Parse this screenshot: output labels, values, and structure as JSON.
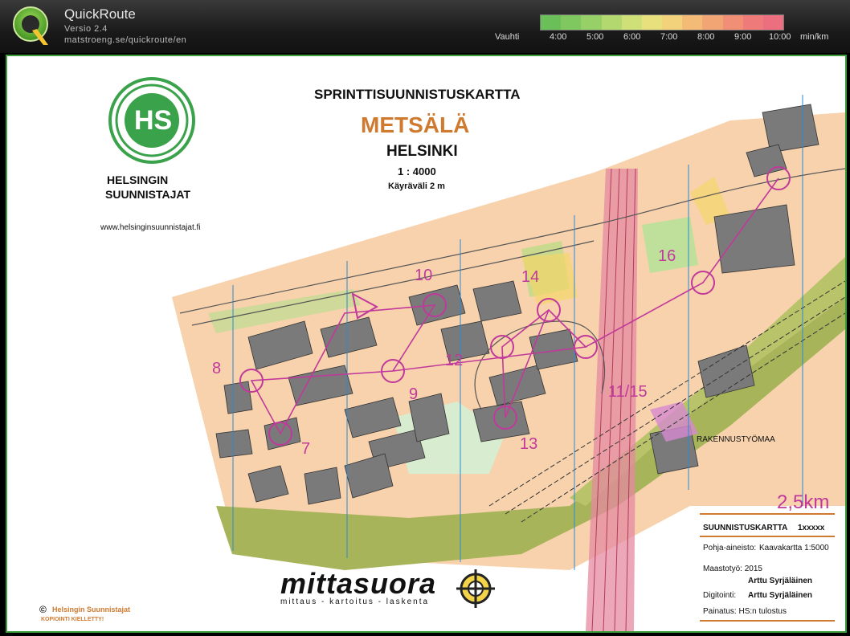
{
  "header": {
    "app_title": "QuickRoute",
    "version": "Versio 2.4",
    "url": "matstroeng.se/quickroute/en",
    "logo_letter": "Q"
  },
  "pace_scale": {
    "label": "Vauhti",
    "unit": "min/km",
    "ticks": [
      "4:00",
      "5:00",
      "6:00",
      "7:00",
      "8:00",
      "9:00",
      "10:00"
    ],
    "colors": [
      "#6bbf59",
      "#7fc860",
      "#98d068",
      "#b3d870",
      "#cfe078",
      "#e8e07c",
      "#f2d27a",
      "#f4bb76",
      "#f2a574",
      "#f08f76",
      "#ee7a7a",
      "#ec6f80"
    ]
  },
  "map": {
    "title": "SPRINTTISUUNNISTUSKARTTA",
    "name": "METSÄLÄ",
    "city": "HELSINKI",
    "scale": "1 : 4000",
    "contour": "Käyräväli  2 m",
    "club_line1": "HELSINGIN",
    "club_line2": "SUUNNISTAJAT",
    "club_url": "www.helsinginsuunnistajat.fi",
    "club_logo_letters": "HS",
    "distance": "2,5km",
    "construction_label": "RAKENNUSTYÖMAA",
    "controls": [
      "7",
      "8",
      "9",
      "10",
      "12",
      "13",
      "14",
      "11/15",
      "16"
    ],
    "info": {
      "header": "SUUNNISTUSKARTTA",
      "header_code": "1xxxxx",
      "base_label": "Pohja-aineisto:",
      "base_value": "Kaavakartta 1:5000",
      "survey_label": "Maastotyö: 2015",
      "survey_person": "Arttu Syrjäläinen",
      "digitizing_label": "Digitointi:",
      "digitizing_person": "Arttu Syrjäläinen",
      "printing": "Painatus: HS:n tulostus"
    },
    "copyright_club": "Helsingin Suunnistajat",
    "copyright_note": "KOPIOINTI KIELLETTY!",
    "copyright_symbol": "©",
    "sponsor_name": "mittasuora",
    "sponsor_tagline": "mittaus - kartoitus - laskenta"
  },
  "colors": {
    "course": "#c0399b",
    "brand_green": "#3aa24a",
    "map_orange": "#d07a30",
    "north_line": "#2a8ad4"
  }
}
